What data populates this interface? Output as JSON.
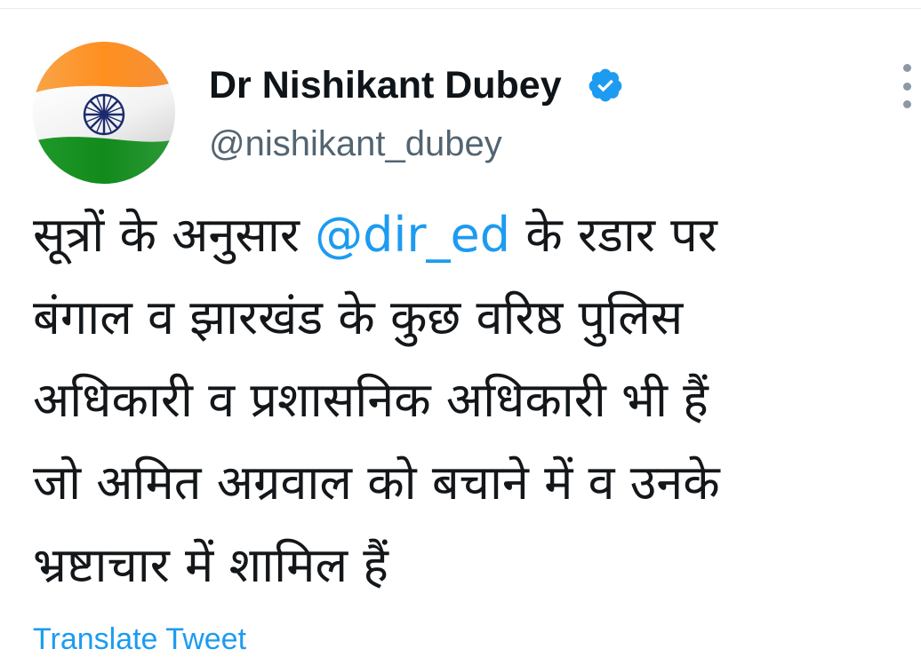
{
  "author": {
    "display_name": "Dr Nishikant Dubey",
    "handle": "@nishikant_dubey",
    "verified": true,
    "avatar_icon": "indian-flag-avatar"
  },
  "tweet": {
    "lines": [
      {
        "before": "सूत्रों के अनुसार ",
        "mention": "@dir_ed",
        "after": " के रडार पर"
      },
      {
        "text": "बंगाल व झारखंड के कुछ वरिष्ठ पुलिस"
      },
      {
        "text": "अधिकारी व प्रशासनिक अधिकारी भी हैं"
      },
      {
        "text": "जो अमित अग्रवाल को बचाने में व उनके"
      },
      {
        "text": "भ्रष्टाचार में शामिल हैं"
      }
    ]
  },
  "translate_link": "Translate Tweet",
  "colors": {
    "accent": "#1d9bf0",
    "handle_gray": "#536471",
    "saffron": "#ff9933",
    "india_green": "#138808",
    "chakra_navy": "#000080"
  }
}
